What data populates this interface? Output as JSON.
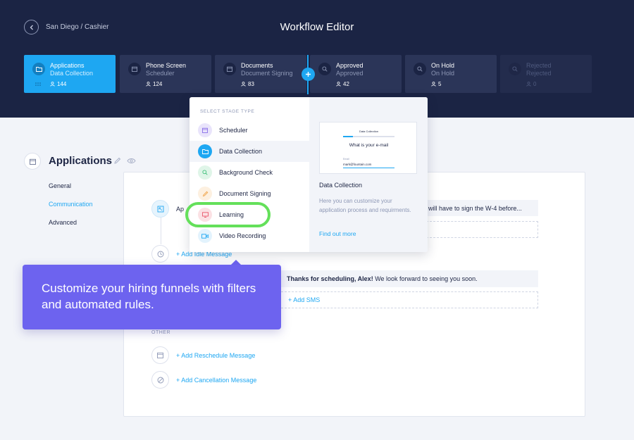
{
  "header": {
    "breadcrumb": "San Diego / Cashier",
    "title": "Workflow Editor"
  },
  "stages": [
    {
      "name": "Applications",
      "type": "Data Collection",
      "count": "144",
      "icon": "folder-icon"
    },
    {
      "name": "Phone Screen",
      "type": "Scheduler",
      "count": "124",
      "icon": "calendar-icon"
    },
    {
      "name": "Documents",
      "type": "Document Signing",
      "count": "83",
      "icon": "calendar-icon"
    },
    {
      "name": "Approved",
      "type": "Approved",
      "count": "42",
      "icon": "search-icon"
    },
    {
      "name": "On Hold",
      "type": "On Hold",
      "count": "5",
      "icon": "search-icon"
    },
    {
      "name": "Rejected",
      "type": "Rejected",
      "count": "0",
      "icon": "search-icon"
    }
  ],
  "page": {
    "title": "Applications"
  },
  "side_nav": {
    "items": [
      "General",
      "Communication",
      "Advanced"
    ],
    "active": "Communication"
  },
  "card": {
    "partial_label": "Ap",
    "w4_message": "will have to sign the W-4 before...",
    "add_idle": "+ Add Idle Message",
    "scheduling_bold": "Thanks for scheduling, Alex!",
    "scheduling_rest": " We look forward to seeing you soon.",
    "add_sms": "+ Add SMS",
    "other_label": "OTHER",
    "add_reschedule": "+ Add Reschedule Message",
    "add_cancellation": "+ Add Cancellation Message"
  },
  "dropdown": {
    "label": "SELECT STAGE TYPE",
    "items": [
      {
        "label": "Scheduler",
        "icon": "calendar-icon",
        "color": "#e9e4fb"
      },
      {
        "label": "Data Collection",
        "icon": "folder-icon",
        "color": "#1ea7f2"
      },
      {
        "label": "Background Check",
        "icon": "search-icon",
        "color": "#dff5e8"
      },
      {
        "label": "Document Signing",
        "icon": "pen-icon",
        "color": "#fdf0e0"
      },
      {
        "label": "Learning",
        "icon": "monitor-icon",
        "color": "#fbe1e4"
      },
      {
        "label": "Video Recording",
        "icon": "video-icon",
        "color": "#e3f3fd"
      }
    ],
    "selected": "Data Collection",
    "preview": {
      "small_title": "Data Collection",
      "question": "What is your e-mail",
      "field_label": "Email",
      "field_value": "mark@fountain.com"
    },
    "detail_title": "Data Collection",
    "detail_desc": "Here you can customize your application process and requirments.",
    "detail_link": "Find out more"
  },
  "callout": {
    "text": "Customize your hiring funnels with filters and automated rules."
  },
  "colors": {
    "header_bg": "#1b2444",
    "accent": "#1ea7f2",
    "callout": "#6d63ef",
    "highlight": "#64e05a"
  }
}
